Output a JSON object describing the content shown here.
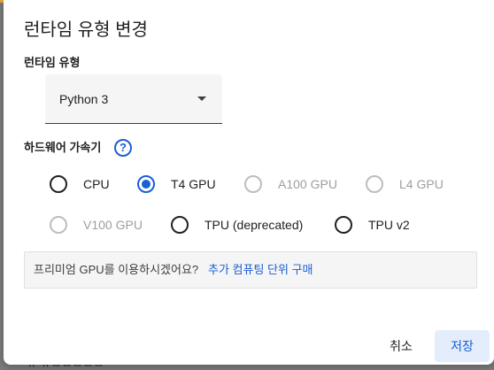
{
  "dialog": {
    "title": "런타임 유형 변경",
    "runtime_type": {
      "label": "런타임 유형",
      "selected": "Python 3"
    },
    "accelerator": {
      "label": "하드웨어 가속기",
      "help_icon": "?",
      "options": [
        {
          "label": "CPU",
          "state": "unselected"
        },
        {
          "label": "T4 GPU",
          "state": "selected"
        },
        {
          "label": "A100 GPU",
          "state": "disabled"
        },
        {
          "label": "L4 GPU",
          "state": "disabled"
        },
        {
          "label": "V100 GPU",
          "state": "disabled"
        },
        {
          "label": "TPU (deprecated)",
          "state": "unselected"
        },
        {
          "label": "TPU v2",
          "state": "unselected"
        }
      ]
    },
    "premium_notice": {
      "text": "프리미엄 GPU를 이용하시겠어요?",
      "link": "추가 컴퓨팅 단위 구매"
    },
    "buttons": {
      "cancel": "취소",
      "save": "저장"
    }
  },
  "background": {
    "partial_text": "ㅠ ㅠㅁㅁㅁㅁㅁ"
  },
  "colors": {
    "accent": "#1a5fd4",
    "top_strip": "#e8a33a",
    "save_button_bg": "#e3edfb"
  }
}
